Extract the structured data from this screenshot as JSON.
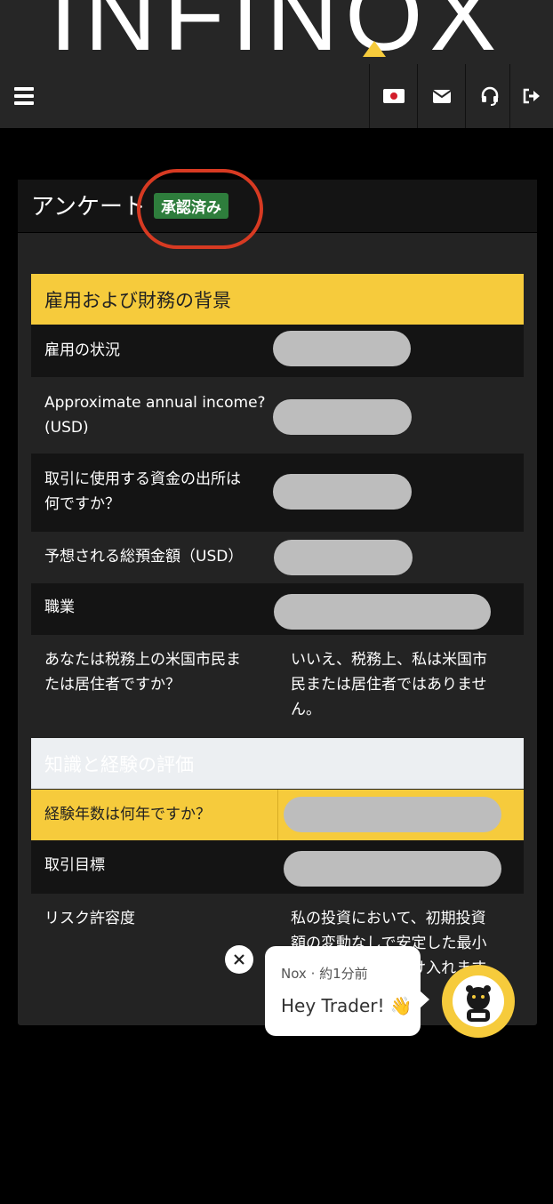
{
  "brand": {
    "logo_text": "INFINOX"
  },
  "nav": {
    "menu_icon": "hamburger-icon",
    "buttons": [
      "japan-flag-icon",
      "mail-icon",
      "headset-icon",
      "logout-icon"
    ]
  },
  "card": {
    "title": "アンケート",
    "badge": "承認済み"
  },
  "sections": {
    "employment": {
      "title": "雇用および財務の背景",
      "rows": [
        {
          "label": "雇用の状況"
        },
        {
          "label": "Approximate annual income?\n(USD)"
        },
        {
          "label": "取引に使用する資金の出所は\n何ですか？"
        },
        {
          "label": "予想される総預金額（USD）"
        },
        {
          "label": "職業"
        },
        {
          "label": "あなたは税務上の米国市民ま\nたは居住者ですか？",
          "value": "いいえ、税務上、私は米国市\n民または居住者ではありませ\nん。"
        }
      ]
    },
    "knowledge": {
      "title": "知識と経験の評価",
      "rows": [
        {
          "label": "経験年数は何年ですか？"
        },
        {
          "label": "取引目標"
        },
        {
          "label": "リスク許容度",
          "value": "私の投資において、初期投資\n額の変動なしで安定した最小\n限のリターンを受け入れます"
        }
      ]
    }
  },
  "chat": {
    "meta": "Nox · 約1分前",
    "message": "Hey Trader! 👋"
  },
  "colors": {
    "accent": "#f6cb3c",
    "badge": "#2e7d3c",
    "ring": "#d73a22"
  }
}
